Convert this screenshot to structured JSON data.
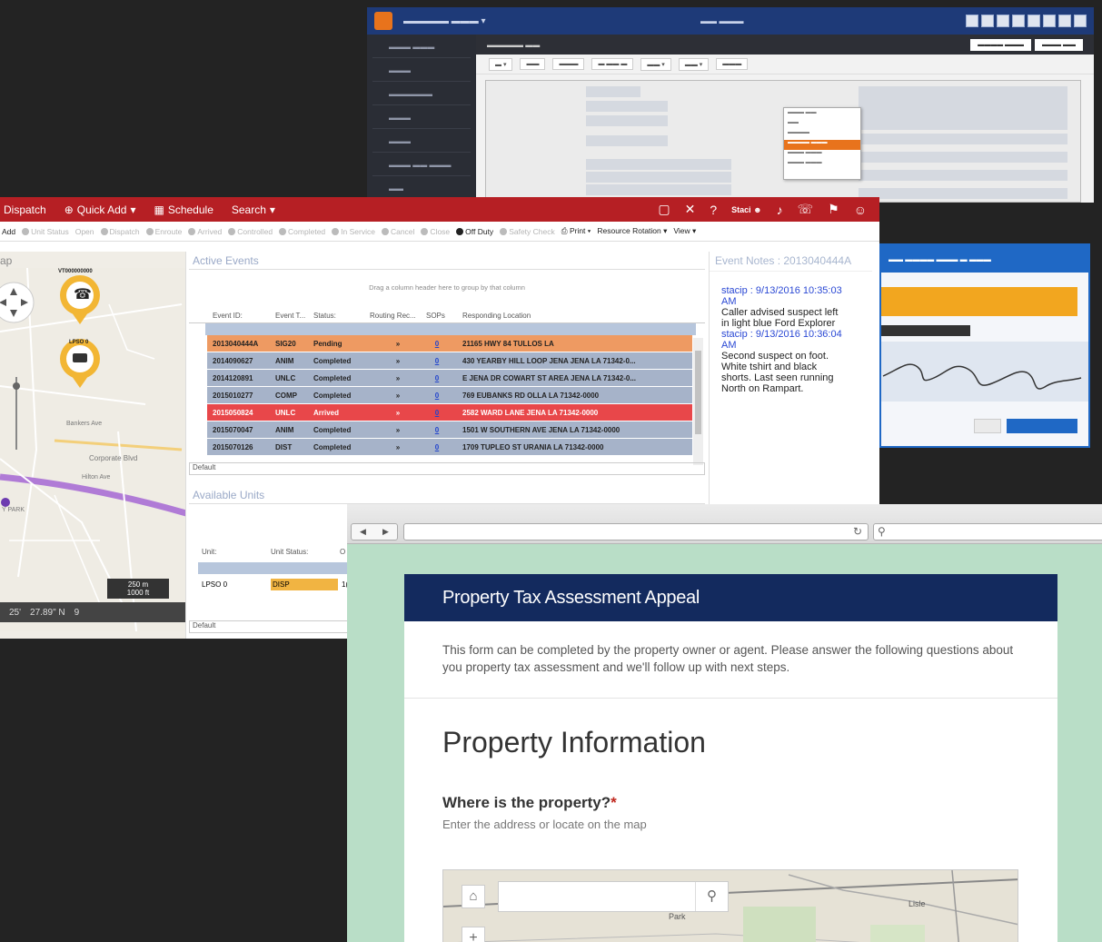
{
  "dispatch": {
    "menu": {
      "dispatch_label": "Dispatch",
      "quick_add_label": "Quick Add",
      "schedule_label": "Schedule",
      "search_label": "Search",
      "user_label": "Staci"
    },
    "toolbar": {
      "add": "Add",
      "unit_status": "Unit Status",
      "open": "Open",
      "dispatch": "Dispatch",
      "enroute": "Enroute",
      "arrived": "Arrived",
      "controlled": "Controlled",
      "completed": "Completed",
      "in_service": "In Service",
      "cancel": "Cancel",
      "close": "Close",
      "off_duty": "Off Duty",
      "safety_check": "Safety Check",
      "print": "Print",
      "resource_rotation": "Resource Rotation",
      "view": "View"
    },
    "map": {
      "title": "ap",
      "unit_labels": [
        "VT000000000",
        "LPSO 0"
      ],
      "street_labels": [
        "Bankers Ave",
        "Corporate Blvd",
        "Hilton Ave",
        "Y PARK"
      ],
      "coords_left": "25'",
      "coords_mid": "27.89\" N",
      "coords_right": "9",
      "scale_top": "250 m",
      "scale_bottom": "1000 ft"
    },
    "events": {
      "title": "Active Events",
      "group_hint": "Drag a column header here to group by that column",
      "columns": [
        "Event ID:",
        "Event T...",
        "Status:",
        "Routing Rec...",
        "SOPs",
        "Responding Location"
      ],
      "rows": [
        {
          "id": "2013040444A",
          "type": "SIG20",
          "status": "Pending",
          "routing": "»",
          "sops": "0",
          "location": "21165 HWY 84 TULLOS LA",
          "color": "#ee9a62"
        },
        {
          "id": "2014090627",
          "type": "ANIM",
          "status": "Completed",
          "routing": "»",
          "sops": "0",
          "location": "430 YEARBY HILL LOOP JENA JENA LA 71342-0...",
          "color": "#a6b3c9"
        },
        {
          "id": "2014120891",
          "type": "UNLC",
          "status": "Completed",
          "routing": "»",
          "sops": "0",
          "location": "E JENA DR COWART ST AREA JENA LA 71342-0...",
          "color": "#a6b3c9"
        },
        {
          "id": "2015010277",
          "type": "COMP",
          "status": "Completed",
          "routing": "»",
          "sops": "0",
          "location": "769 EUBANKS RD OLLA LA 71342-0000",
          "color": "#a6b3c9"
        },
        {
          "id": "2015050824",
          "type": "UNLC",
          "status": "Arrived",
          "routing": "»",
          "sops": "0",
          "location": "2582 WARD LANE JENA LA 71342-0000",
          "color": "#e8474a"
        },
        {
          "id": "2015070047",
          "type": "ANIM",
          "status": "Completed",
          "routing": "»",
          "sops": "0",
          "location": "1501 W SOUTHERN AVE JENA LA 71342-0000",
          "color": "#a6b3c9"
        },
        {
          "id": "2015070126",
          "type": "DIST",
          "status": "Completed",
          "routing": "»",
          "sops": "0",
          "location": "1709 TUPLEO ST URANIA LA 71342-0000",
          "color": "#a6b3c9"
        }
      ],
      "footer": "Default"
    },
    "notes": {
      "title": "Event Notes : 2013040444A",
      "entries": [
        {
          "who": "stacip : 9/13/2016 10:35:03 AM",
          "text": "Caller advised suspect left in light blue Ford Explorer"
        },
        {
          "who": "stacip : 9/13/2016 10:36:04 AM",
          "text": "Second suspect on foot. White tshirt and black shorts. Last seen running North on Rampart."
        }
      ]
    },
    "units": {
      "title": "Available Units",
      "columns": [
        "Unit:",
        "Unit Status:",
        "O"
      ],
      "row": {
        "unit": "LPSO 0",
        "status": "DISP",
        "extra": "1("
      },
      "footer": "Default"
    }
  },
  "property_form": {
    "banner_title": "Property Tax Assessment Appeal",
    "intro": "This form can be completed by the property owner or agent. Please answer the following questions about you property tax assessment and we'll follow up with next steps.",
    "section_title": "Property Information",
    "question": "Where is the property?",
    "required_mark": "*",
    "hint": "Enter the address or locate on the map",
    "map_labels": [
      "Park",
      "Lisle"
    ]
  },
  "colors": {
    "dispatch_red": "#b61f24",
    "form_navy": "#132a5e",
    "form_bg": "#b9dec7",
    "workorder_blue": "#1e3a78",
    "signature_blue": "#1f68c5"
  }
}
